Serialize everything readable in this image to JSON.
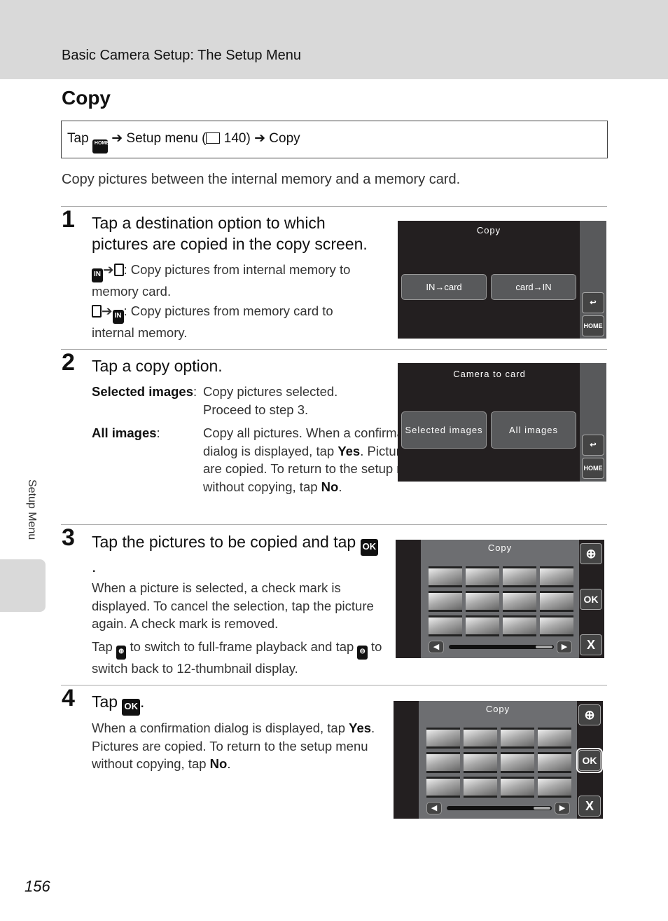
{
  "header": {
    "section": "Basic Camera Setup: The Setup Menu"
  },
  "title": "Copy",
  "nav": {
    "tap": "Tap",
    "home_icon": "HOME",
    "arrow": "➔",
    "setup_menu": "Setup menu (",
    "ref": "140)",
    "copy": "Copy"
  },
  "description": "Copy pictures between the internal memory and a memory card.",
  "steps": [
    {
      "num": "1",
      "heading": "Tap a destination option to which pictures are copied in the copy screen.",
      "opt1": ": Copy pictures from internal memory to memory card.",
      "opt2": ": Copy pictures from memory card to internal memory.",
      "screen": {
        "title": "Copy",
        "btn1": "IN→card",
        "btn2": "card→IN",
        "back": "↩",
        "home": "HOME"
      }
    },
    {
      "num": "2",
      "heading": "Tap a copy option.",
      "sel_label": "Selected images",
      "sel_text": "Copy pictures selected. Proceed to step 3.",
      "all_label": "All images",
      "all_text1": "Copy all pictures. When a confirmation dialog is displayed, tap ",
      "yes": "Yes",
      "all_text2": ". Pictures are copied. To return to the setup menu without copying, tap ",
      "no": "No",
      "period": ".",
      "screen": {
        "title": "Camera to card",
        "btn1": "Selected images",
        "btn2": "All images",
        "back": "↩",
        "home": "HOME"
      }
    },
    {
      "num": "3",
      "heading": "Tap the pictures to be copied and tap",
      "ok": "OK",
      "p1": "When a picture is selected, a check mark is displayed. To cancel the selection, tap the picture again. A check mark is removed.",
      "p2a": "Tap ",
      "p2b": " to switch to full-frame playback and tap ",
      "p2c": " to switch back to 12-thumbnail display.",
      "screen": {
        "title": "Copy",
        "zoom": "⊕",
        "ok": "OK",
        "close": "X",
        "prev": "◀",
        "next": "▶"
      }
    },
    {
      "num": "4",
      "heading": "Tap",
      "ok": "OK",
      "p1a": "When a confirmation dialog is displayed, tap ",
      "yes": "Yes",
      "p1b": ". Pictures are copied. To return to the setup menu without copying, tap ",
      "no": "No",
      "period": ".",
      "screen": {
        "title": "Copy",
        "zoom": "⊕",
        "ok": "OK",
        "close": "X",
        "prev": "◀",
        "next": "▶"
      }
    }
  ],
  "side_label": "Setup Menu",
  "page_number": "156"
}
